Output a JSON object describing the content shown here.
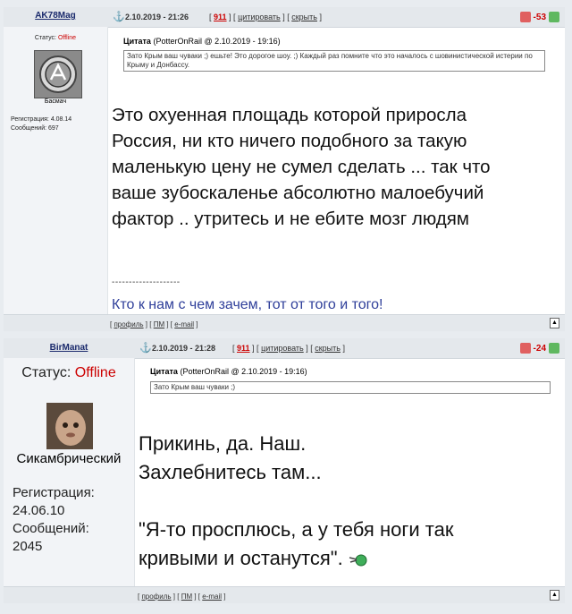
{
  "post1": {
    "username": "AK78Mag",
    "date": "2.10.2019 - 21:26",
    "reply_count": "911",
    "quote_link": "цитировать",
    "hide_link": "скрыть",
    "score": "-53",
    "status_label": "Статус:",
    "status_value": "Offline",
    "user_title": "Басмач",
    "reg_label": "Регистрация:",
    "reg_value": "4.08.14",
    "msgs_label": "Сообщений:",
    "msgs_value": "697",
    "quote_label": "Цитата",
    "quote_source": "(PotterOnRail @ 2.10.2019 - 19:16)",
    "quote_text": "Зато Крым ваш чуваки ;) ешьте! Это дорогое шоу. ;) Каждый раз помните что это началось с шовинистической истерии по Крыму и Донбассу.",
    "body_lines": [
      "Это охуенная площадь которой приросла",
      "Россия, ни кто ничего подобного за такую",
      "маленькую цену не сумел сделать ... так что",
      "ваше зубоскаленье абсолютно малоебучий",
      "фактор .. утритесь и не ебите мозг людям"
    ],
    "sig_separator": "--------------------",
    "signature": "Кто к нам с чем зачем, тот от того и того!",
    "foot_profile": "профиль",
    "foot_pm": "ПМ",
    "foot_email": "e-mail"
  },
  "post2": {
    "username": "BirManat",
    "date": "2.10.2019 - 21:28",
    "reply_count": "911",
    "quote_link": "цитировать",
    "hide_link": "скрыть",
    "score": "-24",
    "status_label": "Статус:",
    "status_value": "Offline",
    "user_title": "Сикамбрический",
    "reg_label": "Регистрация:",
    "reg_value": "24.06.10",
    "msgs_label": "Сообщений:",
    "msgs_value": "2045",
    "quote_label": "Цитата",
    "quote_source": "(PotterOnRail @ 2.10.2019 - 19:16)",
    "quote_text": "Зато Крым ваш чуваки ;)",
    "body_lines": [
      "Прикинь, да. Наш.",
      "Захлебнитесь там...",
      "",
      "\"Я-то просплюсь, а у тебя ноги так",
      "кривыми и останутся\"."
    ],
    "foot_profile": "профиль",
    "foot_pm": "ПМ",
    "foot_email": "e-mail"
  }
}
